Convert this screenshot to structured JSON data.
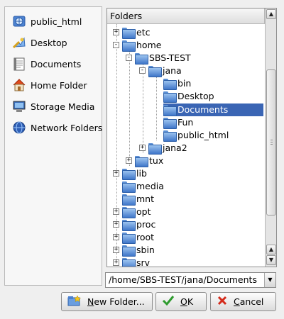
{
  "places": [
    {
      "label": "public_html",
      "icon": "globe-folder-icon"
    },
    {
      "label": "Desktop",
      "icon": "desktop-icon"
    },
    {
      "label": "Documents",
      "icon": "document-icon"
    },
    {
      "label": "Home Folder",
      "icon": "home-icon"
    },
    {
      "label": "Storage Media",
      "icon": "computer-icon"
    },
    {
      "label": "Network Folders",
      "icon": "network-icon"
    }
  ],
  "tree": {
    "header": "Folders",
    "items": [
      {
        "label": "etc",
        "expander": "+",
        "icon": "folder-icon"
      },
      {
        "label": "home",
        "expander": "-",
        "icon": "folder-icon"
      },
      {
        "label": "SBS-TEST",
        "expander": "-",
        "icon": "folder-icon"
      },
      {
        "label": "jana",
        "expander": "-",
        "icon": "folder-icon"
      },
      {
        "label": "bin",
        "expander": "",
        "icon": "folder-icon"
      },
      {
        "label": "Desktop",
        "expander": "",
        "icon": "desktop-icon"
      },
      {
        "label": "Documents",
        "expander": "",
        "icon": "folder-icon",
        "selected": true
      },
      {
        "label": "Fun",
        "expander": "",
        "icon": "folder-icon"
      },
      {
        "label": "public_html",
        "expander": "",
        "icon": "folder-icon"
      },
      {
        "label": "jana2",
        "expander": "+",
        "icon": "folder-icon"
      },
      {
        "label": "tux",
        "expander": "+",
        "icon": "folder-icon"
      },
      {
        "label": "lib",
        "expander": "+",
        "icon": "folder-icon"
      },
      {
        "label": "media",
        "expander": "",
        "icon": "folder-icon"
      },
      {
        "label": "mnt",
        "expander": "",
        "icon": "folder-icon"
      },
      {
        "label": "opt",
        "expander": "+",
        "icon": "folder-icon"
      },
      {
        "label": "proc",
        "expander": "+",
        "icon": "folder-icon"
      },
      {
        "label": "root",
        "expander": "+",
        "icon": "locked-folder-icon"
      },
      {
        "label": "sbin",
        "expander": "+",
        "icon": "folder-icon"
      },
      {
        "label": "srv",
        "expander": "+",
        "icon": "folder-icon"
      }
    ]
  },
  "path": "/home/SBS-TEST/jana/Documents",
  "buttons": {
    "new_folder": {
      "mnemonic": "N",
      "rest": "ew Folder..."
    },
    "ok": {
      "mnemonic": "O",
      "rest": "K"
    },
    "cancel": {
      "mnemonic": "C",
      "rest": "ancel"
    }
  },
  "colors": {
    "selection": "#3a65b4",
    "folder": "#4a80d0",
    "ok_check": "#2e9b2e",
    "cancel_x": "#d42a1a"
  }
}
